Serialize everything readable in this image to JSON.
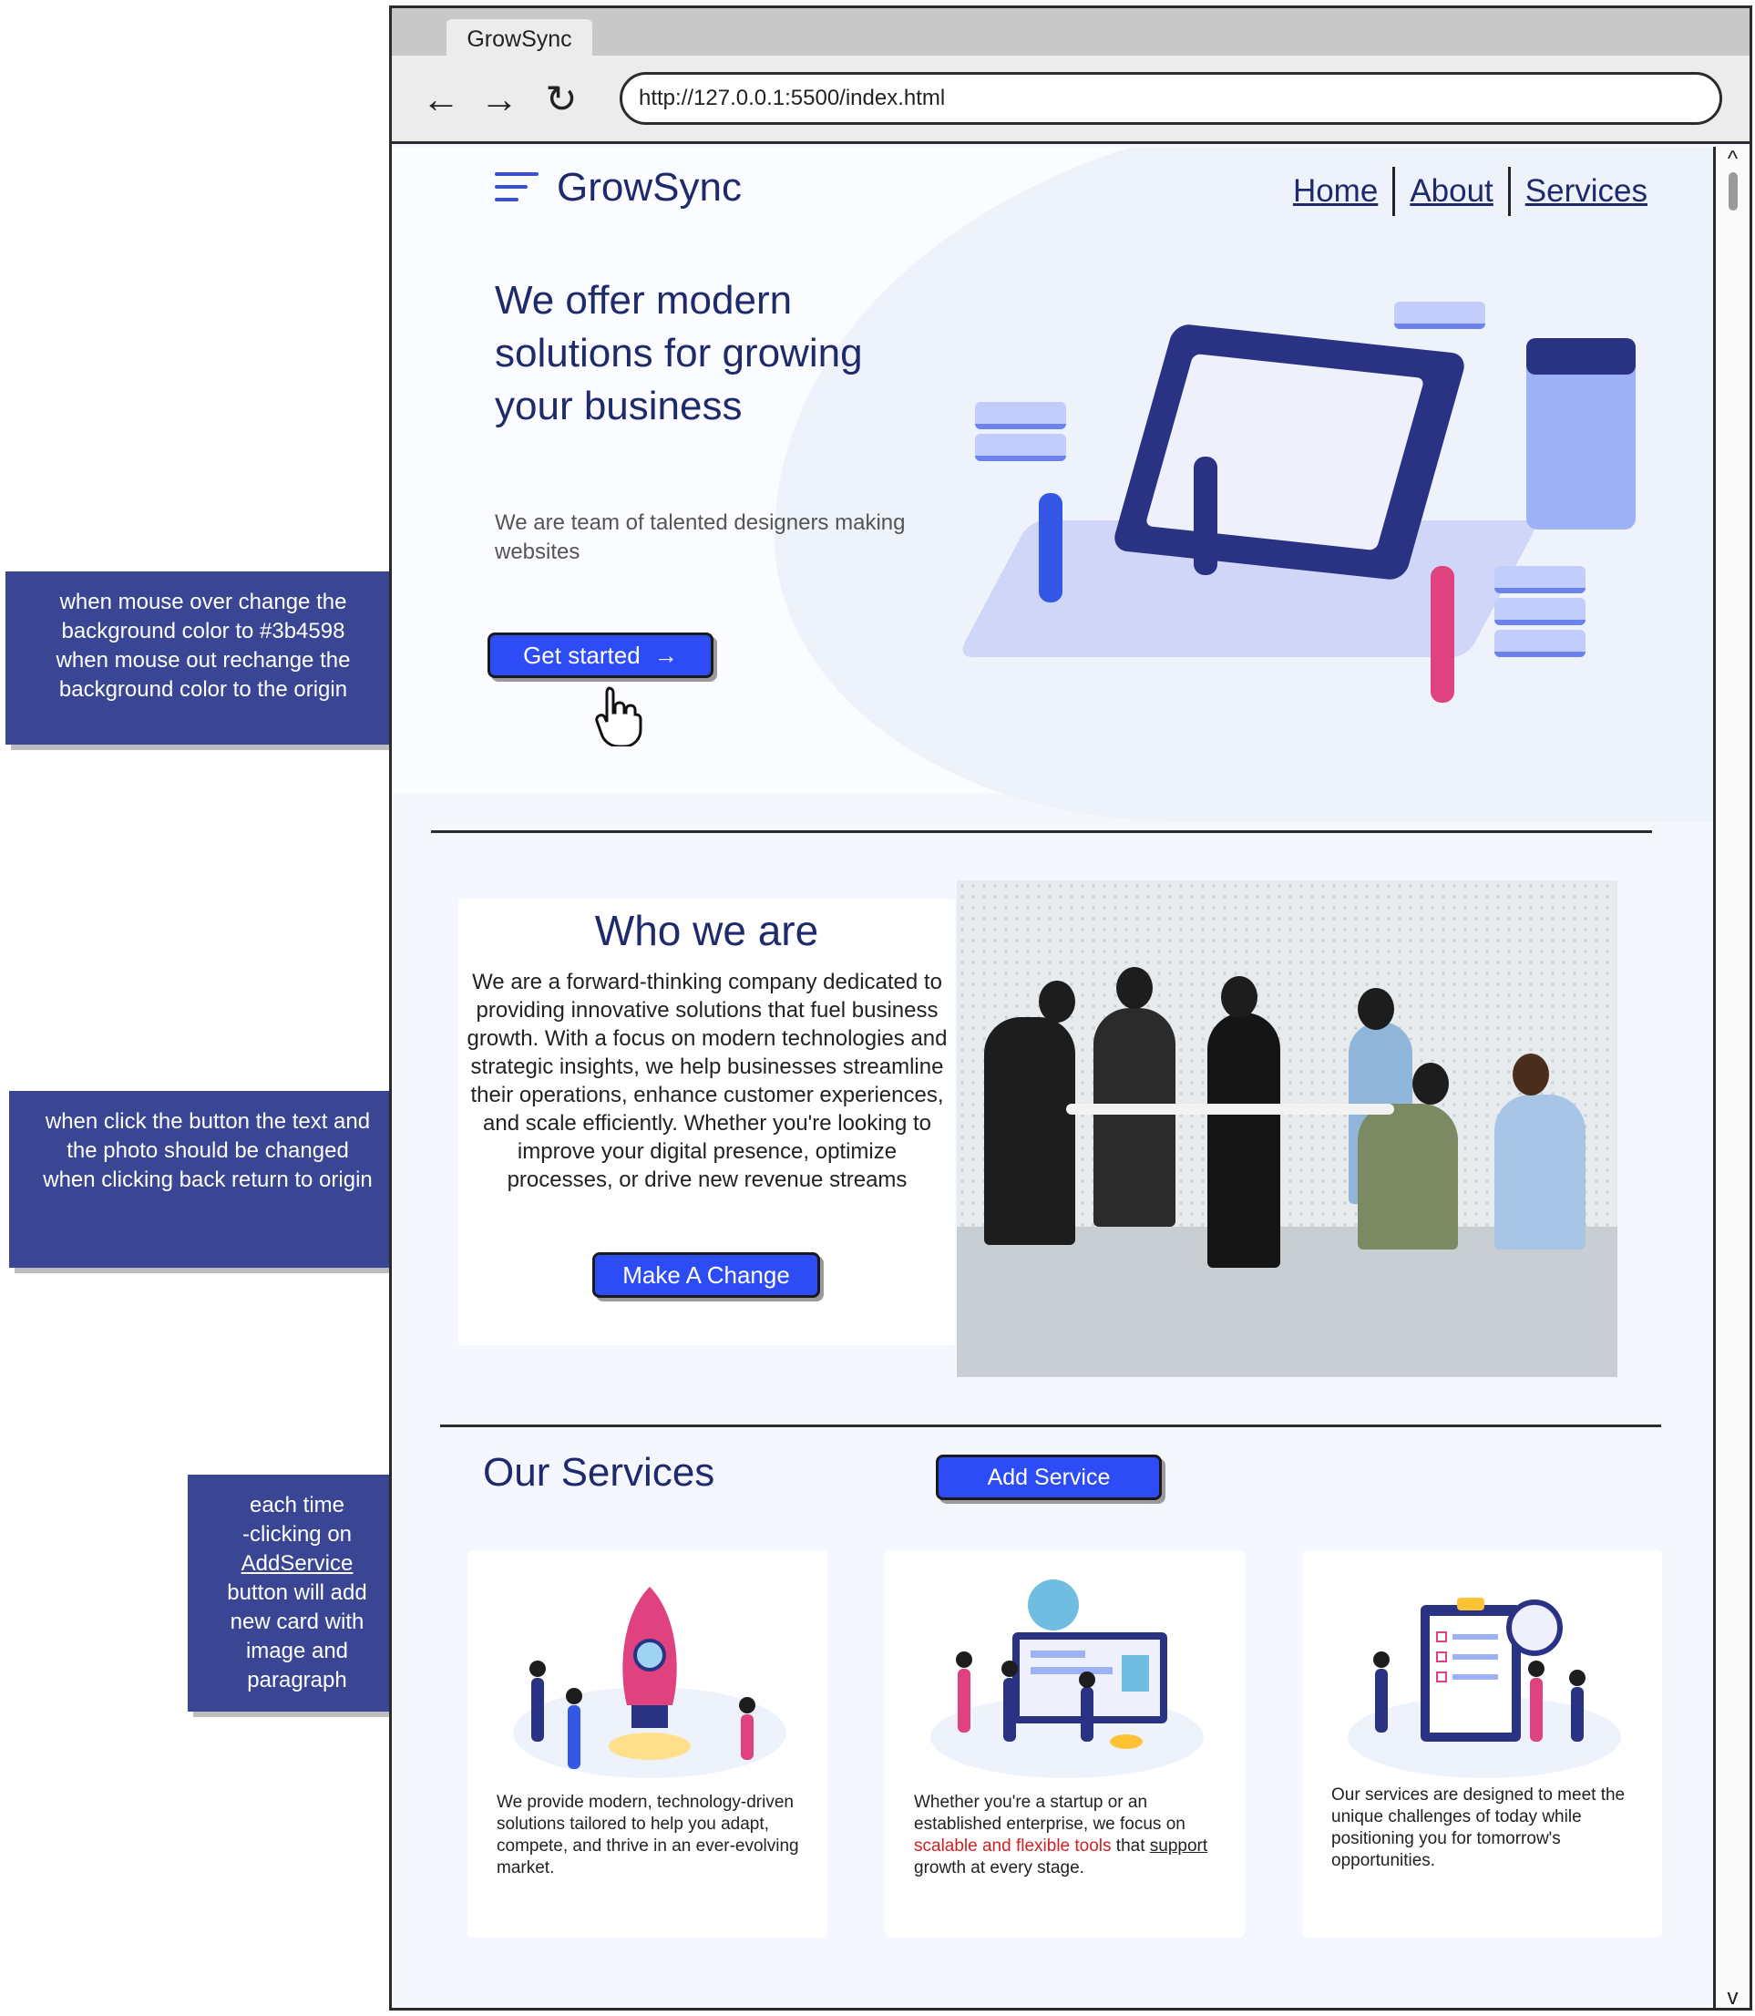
{
  "notes": {
    "hover": [
      "when mouse over change the",
      "background color to  #3b4598",
      "when mouse out rechange the",
      "background color to the origin"
    ],
    "click": [
      "when click the button the text and",
      "the photo should be changed",
      "when clicking back return to origin"
    ],
    "add_before": [
      "each time",
      "-clicking on"
    ],
    "add_link": "AddService",
    "add_after": [
      "button will add",
      "new card with",
      "image and",
      "paragraph"
    ]
  },
  "browser": {
    "tab_title": "GrowSync",
    "url": "http://127.0.0.1:5500/index.html",
    "back_icon": "←",
    "forward_icon": "→",
    "reload_icon": "↻",
    "scroll_up_icon": "^",
    "scroll_down_icon": "v"
  },
  "header": {
    "logo_text": "GrowSync",
    "nav": [
      "Home",
      "About",
      "Services"
    ]
  },
  "hero": {
    "title": "We offer modern solutions for growing your business",
    "subtitle": "We are team of talented designers making websites",
    "cta_label": "Get started",
    "cta_arrow": "→",
    "cursor_icon": "hand-pointer"
  },
  "who": {
    "title": "Who we are",
    "text": "We are a forward-thinking company dedicated to providing innovative solutions that fuel business growth. With a focus on modern technologies and strategic insights, we help businesses streamline their operations, enhance customer experiences, and scale efficiently. Whether you're looking to improve your digital presence, optimize processes, or drive new revenue streams",
    "button_label": "Make A Change"
  },
  "services": {
    "title": "Our Services",
    "add_button_label": "Add Service",
    "cards": [
      {
        "text": "We provide modern, technology-driven solutions tailored to help you adapt, compete, and thrive in an ever-evolving market."
      },
      {
        "text_a": "Whether you're a startup or an established enterprise, we focus on ",
        "text_red": "scalable and flexible tools",
        "text_b": " that ",
        "text_link": "support",
        "text_c": " growth at every stage."
      },
      {
        "text": "Our services are designed to meet the unique challenges of today while positioning you for tomorrow's opportunities."
      }
    ]
  },
  "colors": {
    "accent": "#2e4cf5",
    "hover": "#3b4598",
    "note_bg": "#3a4594",
    "heading": "#1f2a6d",
    "highlight": "#d21f1f"
  }
}
